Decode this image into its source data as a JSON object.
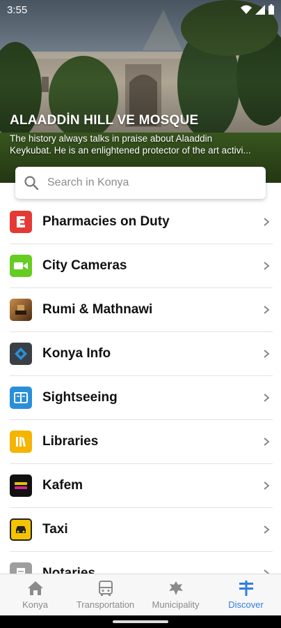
{
  "status": {
    "time": "3:55"
  },
  "hero": {
    "title": "ALAADDİN HILL VE MOSQUE",
    "desc_line1": "The history always talks in praise about Alaaddin",
    "desc_line2": "Keykubat. He is an enlightened protector of the art activi..."
  },
  "search": {
    "placeholder": "Search in Konya"
  },
  "items": [
    {
      "label": "Pharmacies on Duty",
      "icon": "pharmacy-icon",
      "color": "#e53935"
    },
    {
      "label": "City Cameras",
      "icon": "camera-icon",
      "color": "#66cc22"
    },
    {
      "label": "Rumi & Mathnawi",
      "icon": "rumi-icon",
      "color": "#7a4a22"
    },
    {
      "label": "Konya Info",
      "icon": "konya-info-icon",
      "color": "#3a3f46"
    },
    {
      "label": "Sightseeing",
      "icon": "sightseeing-icon",
      "color": "#2a8fd9"
    },
    {
      "label": "Libraries",
      "icon": "libraries-icon",
      "color": "#f5b400"
    },
    {
      "label": "Kafem",
      "icon": "kafem-icon",
      "color": "#111111"
    },
    {
      "label": "Taxi",
      "icon": "taxi-icon",
      "color": "#f5c400"
    },
    {
      "label": "Notaries",
      "icon": "notaries-icon",
      "color": "#9e9e9e"
    }
  ],
  "nav": {
    "konya": "Konya",
    "transportation": "Transportation",
    "municipality": "Municipality",
    "discover": "Discover",
    "active": "discover",
    "active_color": "#2f7de1"
  }
}
